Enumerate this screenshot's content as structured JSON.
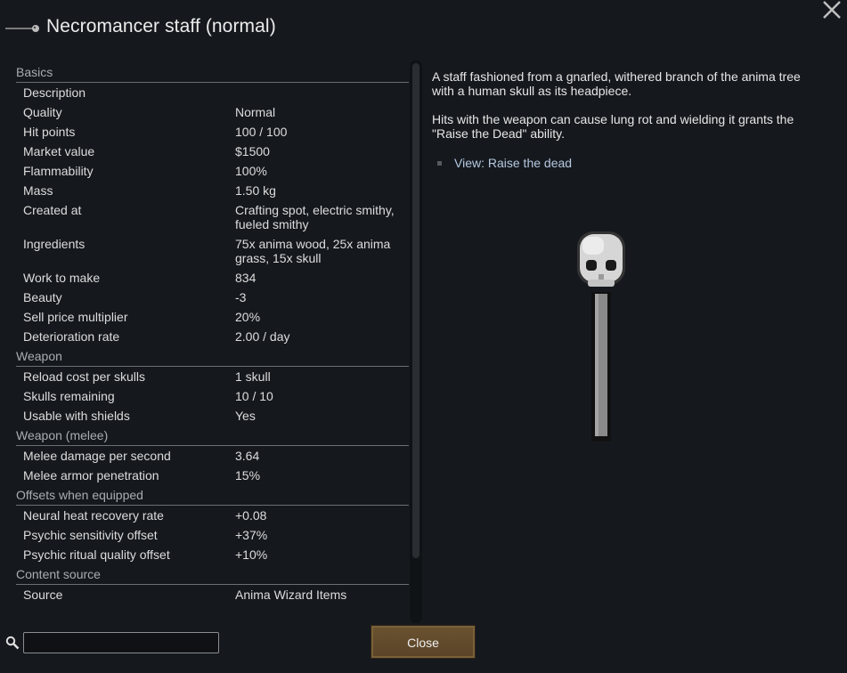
{
  "window": {
    "title": "Necromancer staff (normal)",
    "title_icon": "staff-icon",
    "close_icon": "close-icon"
  },
  "stats": {
    "sections": [
      {
        "name": "Basics",
        "rows": [
          {
            "label": "Description",
            "value": ""
          },
          {
            "label": "Quality",
            "value": "Normal"
          },
          {
            "label": "Hit points",
            "value": "100 / 100"
          },
          {
            "label": "Market value",
            "value": "$1500"
          },
          {
            "label": "Flammability",
            "value": "100%"
          },
          {
            "label": "Mass",
            "value": "1.50 kg"
          },
          {
            "label": "Created at",
            "value": "Crafting spot, electric smithy, fueled smithy"
          },
          {
            "label": "Ingredients",
            "value": "75x anima wood, 25x anima grass, 15x skull"
          },
          {
            "label": "Work to make",
            "value": "834"
          },
          {
            "label": "Beauty",
            "value": "-3"
          },
          {
            "label": "Sell price multiplier",
            "value": "20%"
          },
          {
            "label": "Deterioration rate",
            "value": "2.00 / day"
          }
        ]
      },
      {
        "name": "Weapon",
        "rows": [
          {
            "label": "Reload cost per skulls",
            "value": "1 skull"
          },
          {
            "label": "Skulls remaining",
            "value": "10 / 10"
          },
          {
            "label": "Usable with shields",
            "value": "Yes"
          }
        ]
      },
      {
        "name": "Weapon (melee)",
        "rows": [
          {
            "label": "Melee damage per second",
            "value": "3.64"
          },
          {
            "label": "Melee armor penetration",
            "value": "15%"
          }
        ]
      },
      {
        "name": "Offsets when equipped",
        "rows": [
          {
            "label": "Neural heat recovery rate",
            "value": "+0.08"
          },
          {
            "label": "Psychic sensitivity offset",
            "value": "+37%"
          },
          {
            "label": "Psychic ritual quality offset",
            "value": "+10%"
          }
        ]
      },
      {
        "name": "Content source",
        "rows": [
          {
            "label": "Source",
            "value": "Anima Wizard Items"
          }
        ]
      }
    ]
  },
  "description": {
    "paragraph1": "A staff fashioned from a gnarled, withered branch of the anima tree with a human skull as its headpiece.",
    "paragraph2": " Hits with the weapon can cause lung rot and wielding it grants the \"Raise the Dead\" ability.",
    "hyperlink": "View: Raise the dead"
  },
  "search": {
    "icon": "search-icon",
    "value": "",
    "placeholder": ""
  },
  "footer": {
    "close_label": "Close"
  },
  "image": {
    "icon": "skull-staff-icon"
  }
}
